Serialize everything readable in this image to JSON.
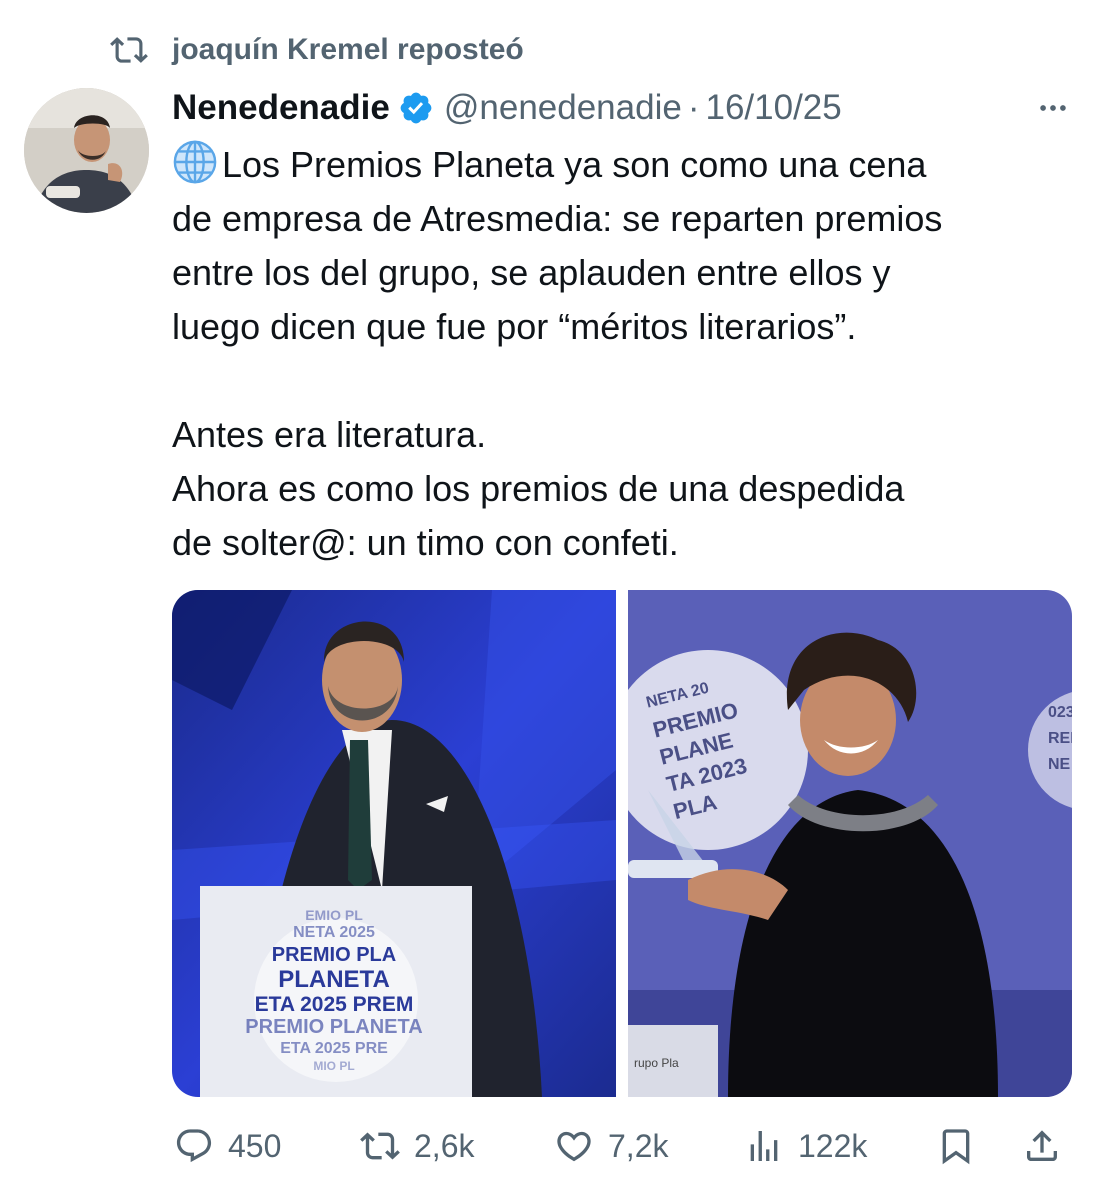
{
  "repost": {
    "text": "joaquín Kremel reposteó"
  },
  "tweet": {
    "author_name": "Nenedenadie",
    "handle": "@nenedenadie",
    "separator": "·",
    "date": "16/10/25",
    "verified": true,
    "paragraphs": [
      [
        "Los Premios Planeta ya son como una cena",
        "de empresa de Atresmedia: se reparten premios",
        "entre los del grupo, se aplauden entre ellos y",
        "luego dicen que fue por “méritos literarios”."
      ],
      [
        "Antes era literatura.",
        "Ahora es como los premios de una despedida",
        "de solter@: un timo con confeti."
      ]
    ],
    "lead_icon": "globe-icon"
  },
  "media": {
    "left_podium_text": [
      "EMIO PL",
      "NETA 2025",
      "PREMIO PLA",
      "PLANETA",
      "ETA 2025 PREM",
      "PREMIO PLANETA",
      "ETA 2025 PRE",
      "MIO PL"
    ],
    "right_globe_text": [
      "NETA 20",
      "PREMIO",
      "PLANE",
      "TA 2023",
      "PLA"
    ],
    "right_side_text": [
      "023",
      "REM",
      "NE"
    ],
    "right_bottom_text": "rupo Pla"
  },
  "actions": {
    "replies": "450",
    "reposts": "2,6k",
    "likes": "7,2k",
    "views": "122k"
  },
  "colors": {
    "accent": "#1d9bf0",
    "muted": "#536471",
    "text": "#0f1419"
  }
}
